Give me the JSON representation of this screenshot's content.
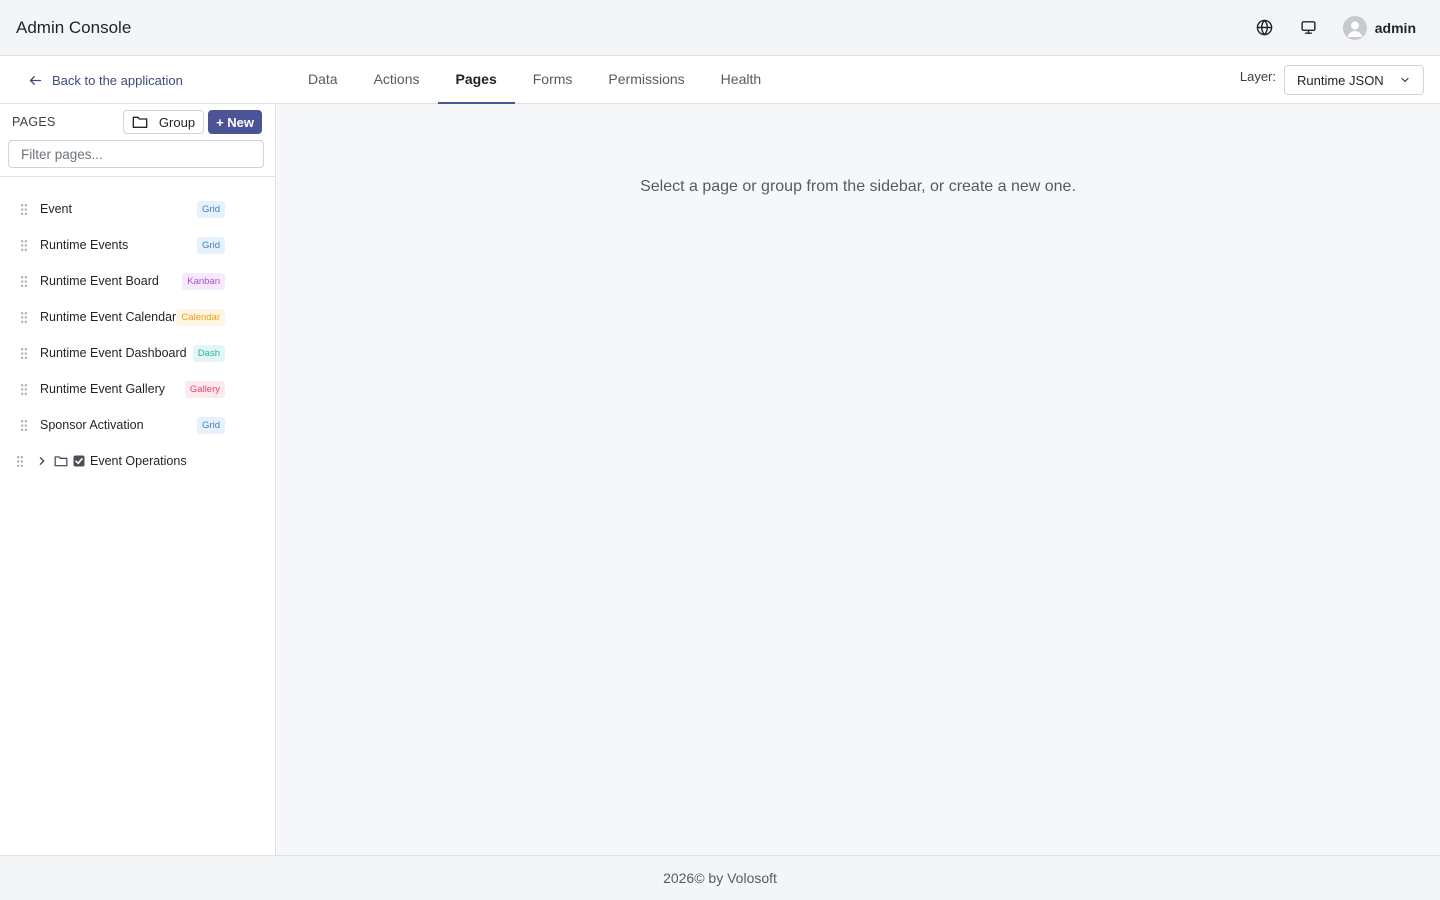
{
  "header": {
    "title": "Admin Console",
    "username": "admin",
    "icons": [
      "globe-icon",
      "monitor-icon",
      "user-avatar-icon"
    ]
  },
  "subnav": {
    "back_label": "Back to the application",
    "tabs": [
      {
        "label": "Data",
        "active": false
      },
      {
        "label": "Actions",
        "active": false
      },
      {
        "label": "Pages",
        "active": true
      },
      {
        "label": "Forms",
        "active": false
      },
      {
        "label": "Permissions",
        "active": false
      },
      {
        "label": "Health",
        "active": false
      }
    ],
    "layer_label": "Layer:",
    "layer_value": "Runtime JSON"
  },
  "sidebar": {
    "title": "PAGES",
    "group_button": "Group",
    "new_button": "+ New",
    "filter_placeholder": "Filter pages...",
    "pages": [
      {
        "name": "Event",
        "badge": "Grid",
        "badge_color": "#3b82c4",
        "badge_bg": "#e7f1fb"
      },
      {
        "name": "Runtime Events",
        "badge": "Grid",
        "badge_color": "#3b82c4",
        "badge_bg": "#e7f1fb"
      },
      {
        "name": "Runtime Event Board",
        "badge": "Kanban",
        "badge_color": "#a855c9",
        "badge_bg": "#f5e9fb"
      },
      {
        "name": "Runtime Event Calendar",
        "badge": "Calendar",
        "badge_color": "#e8a21a",
        "badge_bg": "#fdf4e1"
      },
      {
        "name": "Runtime Event Dashboard",
        "badge": "Dash",
        "badge_color": "#2bb3a3",
        "badge_bg": "#e3f6f3"
      },
      {
        "name": "Runtime Event Gallery",
        "badge": "Gallery",
        "badge_color": "#e0486a",
        "badge_bg": "#fde9ee"
      },
      {
        "name": "Sponsor Activation",
        "badge": "Grid",
        "badge_color": "#3b82c4",
        "badge_bg": "#e7f1fb"
      }
    ],
    "group": {
      "name": "Event Operations",
      "expanded": false
    }
  },
  "main": {
    "empty_message": "Select a page or group from the sidebar, or create a new one."
  },
  "footer": {
    "text": "2026© by Volosoft"
  },
  "colors": {
    "primary": "#4d5495",
    "border": "#dee2e6",
    "background": "#f6f7f9"
  }
}
